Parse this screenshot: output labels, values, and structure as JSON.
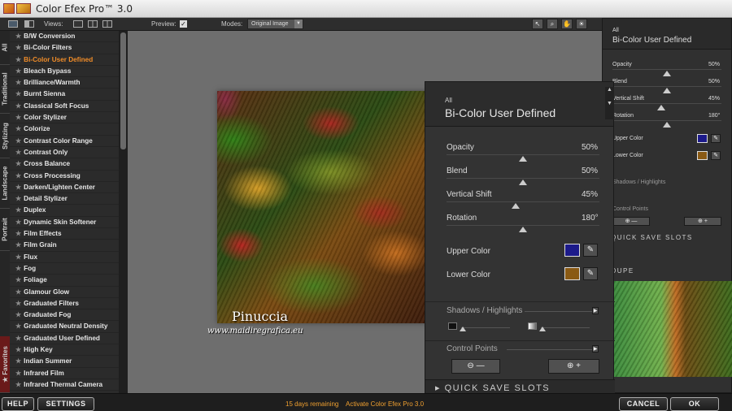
{
  "app": {
    "title": "Color Efex Pro™ 3.0"
  },
  "toolbar": {
    "views_label": "Views:",
    "preview_label": "Preview:",
    "preview_checked": "✓",
    "modes_label": "Modes:",
    "mode_value": "Original Image"
  },
  "category_tabs": [
    "All",
    "Traditional",
    "Stylizing",
    "Landscape",
    "Portrait",
    "Favorites"
  ],
  "filters": [
    "B/W Conversion",
    "Bi-Color Filters",
    "Bi-Color User Defined",
    "Bleach Bypass",
    "Brilliance/Warmth",
    "Burnt Sienna",
    "Classical Soft Focus",
    "Color Stylizer",
    "Colorize",
    "Contrast Color Range",
    "Contrast Only",
    "Cross Balance",
    "Cross Processing",
    "Darken/Lighten Center",
    "Detail Stylizer",
    "Duplex",
    "Dynamic Skin Softener",
    "Film Effects",
    "Film Grain",
    "Flux",
    "Fog",
    "Foliage",
    "Glamour Glow",
    "Graduated Filters",
    "Graduated Fog",
    "Graduated Neutral Density",
    "Graduated User Defined",
    "High Key",
    "Indian Summer",
    "Infrared Film",
    "Infrared Thermal Camera"
  ],
  "active_filter": "Bi-Color User Defined",
  "watermark": {
    "name": "Pinuccia",
    "url": "www.maidiregrafica.eu"
  },
  "panel": {
    "category": "All",
    "title": "Bi-Color User Defined",
    "sliders": [
      {
        "label": "Opacity",
        "value": "50%",
        "level": 0.5
      },
      {
        "label": "Blend",
        "value": "50%",
        "level": 0.5
      },
      {
        "label": "Vertical Shift",
        "value": "45%",
        "level": 0.45
      },
      {
        "label": "Rotation",
        "value": "180°",
        "level": 0.5
      }
    ],
    "upper_color_label": "Upper Color",
    "upper_color": "#1c1a8a",
    "lower_color_label": "Lower Color",
    "lower_color": "#8a5a14",
    "shadows_label": "Shadows / Highlights",
    "control_points_label": "Control Points",
    "quick_save_label": "QUICK SAVE SLOTS",
    "loupe_label": "OUPE"
  },
  "bottom": {
    "help": "HELP",
    "settings": "SETTINGS",
    "days_remaining": "15 days remaining",
    "activate": "Activate Color Efex Pro 3.0",
    "cancel": "CANCEL",
    "ok": "OK"
  }
}
